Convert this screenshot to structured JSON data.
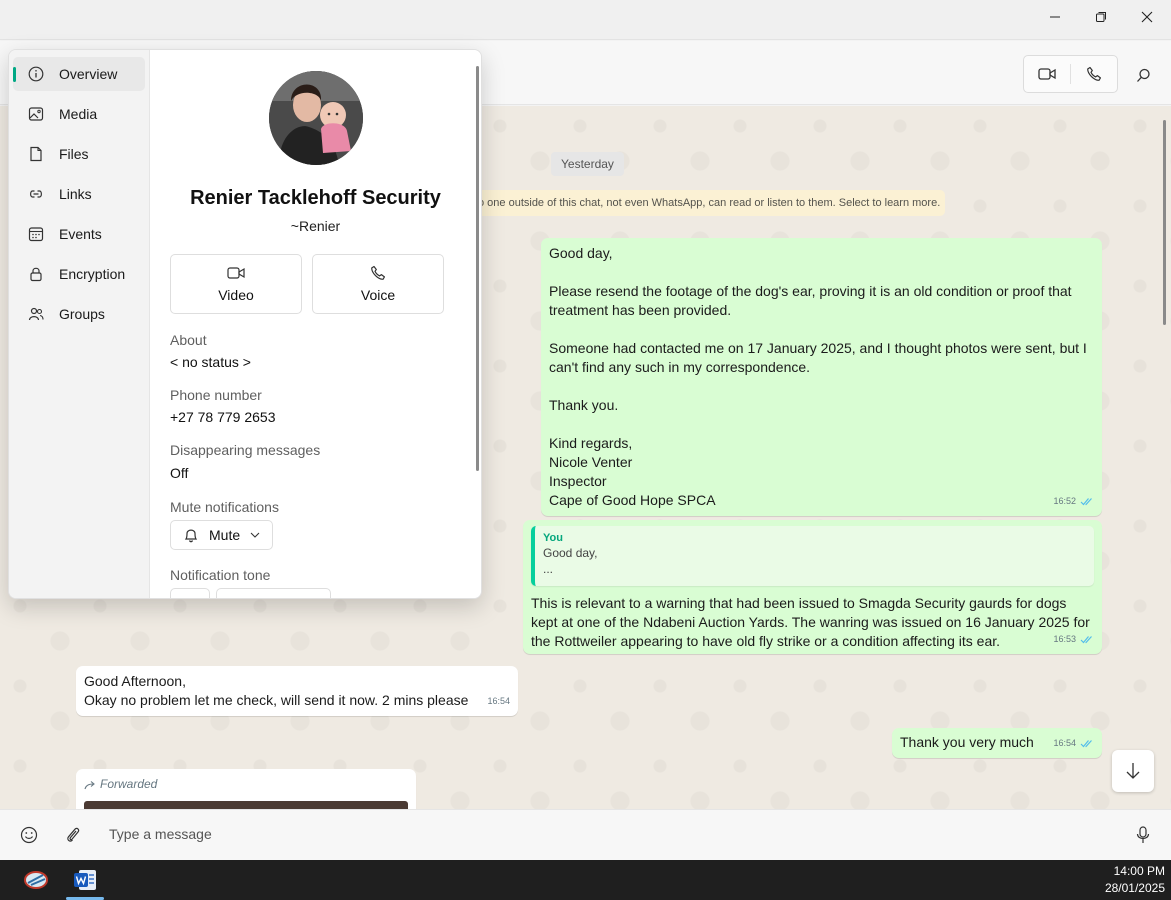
{
  "panel": {
    "nav": [
      {
        "label": "Overview",
        "icon": "info-icon"
      },
      {
        "label": "Media",
        "icon": "image-icon"
      },
      {
        "label": "Files",
        "icon": "file-icon"
      },
      {
        "label": "Links",
        "icon": "link-icon"
      },
      {
        "label": "Events",
        "icon": "calendar-icon"
      },
      {
        "label": "Encryption",
        "icon": "lock-icon"
      },
      {
        "label": "Groups",
        "icon": "people-icon"
      }
    ],
    "contact": {
      "name": "Renier Tacklehoff Security",
      "nickname": "~Renier",
      "video_label": "Video",
      "voice_label": "Voice",
      "about_label": "About",
      "about_value": "< no status >",
      "phone_label": "Phone number",
      "phone_value": "+27 78 779 2653",
      "disappearing_label": "Disappearing messages",
      "disappearing_value": "Off",
      "mute_label": "Mute notifications",
      "mute_value": "Mute",
      "tone_label": "Notification tone"
    }
  },
  "chat": {
    "date_chip": "Yesterday",
    "encryption_notice": "o one outside of this chat, not even WhatsApp, can read or listen to them. Select to learn more.",
    "messages": [
      {
        "lines": [
          "Good day,",
          "",
          "Please resend the footage of the dog's ear, proving it is an old condition or proof that",
          "treatment has been provided.",
          "",
          "Someone had contacted me on 17 January 2025, and I thought photos were sent, but I",
          "can't find any such in my correspondence.",
          "",
          "Thank you.",
          "",
          "Kind regards,",
          "Nicole Venter",
          "Inspector",
          "Cape of Good Hope SPCA"
        ],
        "time": "16:52"
      },
      {
        "quote_author": "You",
        "quote_lines": [
          "Good day,",
          "..."
        ],
        "lines": [
          "This is relevant to a warning that had been issued to Smagda Security gaurds for dogs",
          "kept at one of the Ndabeni Auction Yards. The wanring was issued on 16 January 2025 for",
          "the Rottweiler appearing to have old fly strike or a condition affecting its ear."
        ],
        "time": "16:53"
      },
      {
        "lines": [
          "Good Afternoon,",
          "Okay no problem let me check, will send it now. 2 mins please"
        ],
        "time": "16:54"
      },
      {
        "lines": [
          "Thank you very much"
        ],
        "time": "16:54"
      },
      {
        "forwarded_label": "Forwarded"
      }
    ]
  },
  "composer": {
    "placeholder": "Type a message"
  },
  "taskbar": {
    "time": "14:00 PM",
    "date": "28/01/2025"
  }
}
